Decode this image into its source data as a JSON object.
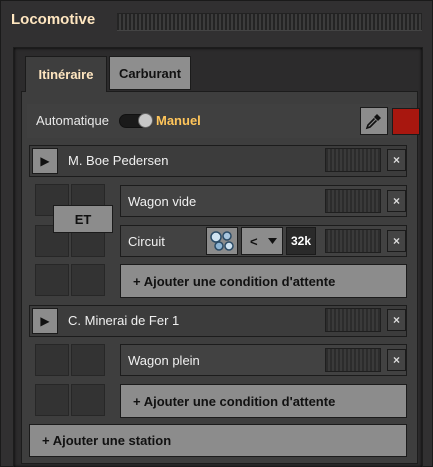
{
  "window": {
    "title": "Locomotive"
  },
  "tabs": [
    {
      "label": "Itinéraire",
      "active": true
    },
    {
      "label": "Carburant",
      "active": false
    }
  ],
  "mode": {
    "auto_label": "Automatique",
    "manual_label": "Manuel",
    "toggle_state": "manual"
  },
  "colors": {
    "accent": "#ffc55a",
    "swatch": "#a8170f"
  },
  "schedule": {
    "stations": [
      {
        "name": "M. Boe Pedersen",
        "logic_button": "ET",
        "conditions": [
          {
            "label": "Wagon vide"
          },
          {
            "label": "Circuit",
            "comparator": "<",
            "value": "32k"
          }
        ],
        "add_condition": "+ Ajouter une condition d'attente"
      },
      {
        "name": "C.  Minerai de Fer 1",
        "conditions": [
          {
            "label": "Wagon plein"
          }
        ],
        "add_condition": "+ Ajouter une condition d'attente"
      }
    ],
    "add_station": "+ Ajouter une station"
  },
  "icons": {
    "play": "play-icon",
    "close": "close-icon",
    "pipette": "pipette-icon",
    "circuit": "circuit-network-icon",
    "dropdown": "chevron-down-icon"
  },
  "glyphs": {
    "close": "×",
    "play": "▶"
  }
}
